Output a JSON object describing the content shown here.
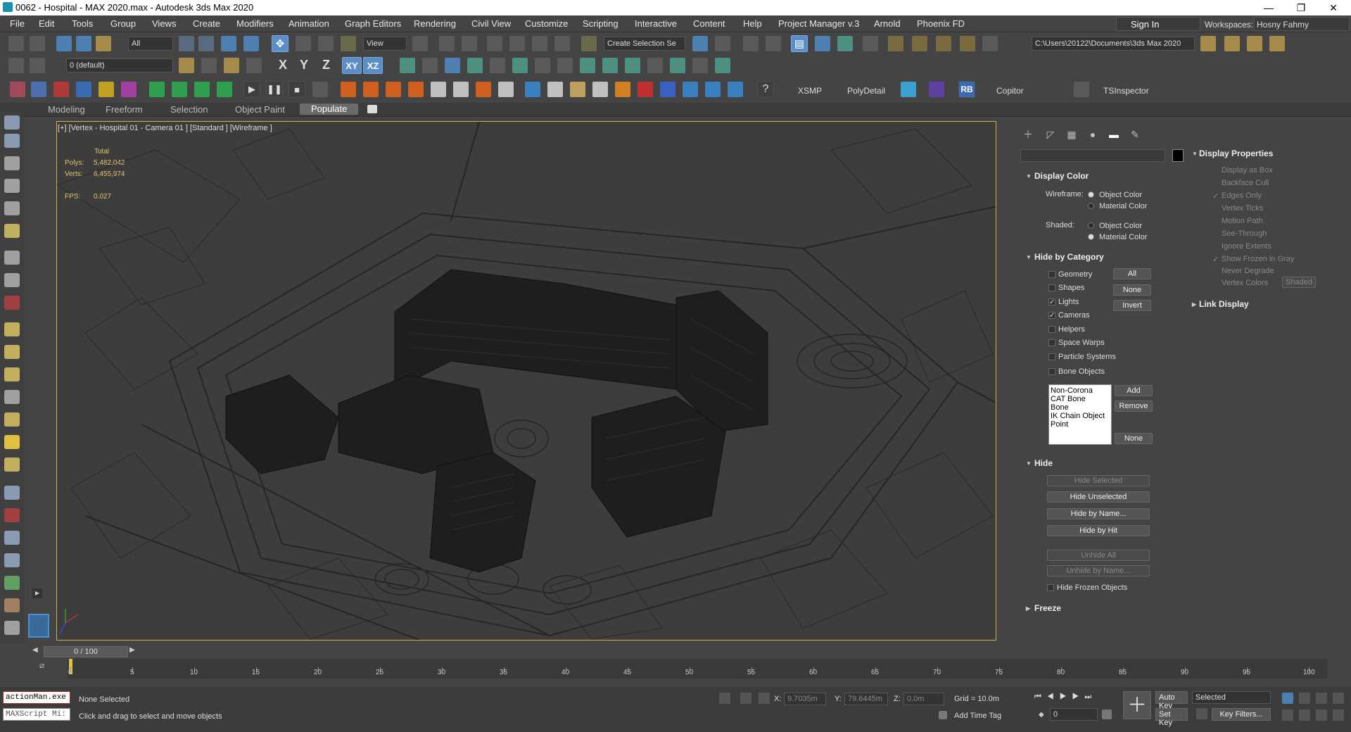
{
  "window": {
    "title": "0062 - Hospital - MAX 2020.max - Autodesk 3ds Max 2020",
    "minimize": "—",
    "maximize": "❐",
    "close": "✕"
  },
  "menu": [
    "File",
    "Edit",
    "Tools",
    "Group",
    "Views",
    "Create",
    "Modifiers",
    "Animation",
    "Graph Editors",
    "Rendering",
    "Civil View",
    "Customize",
    "Scripting",
    "Interactive",
    "Content",
    "Help",
    "Project Manager v.3",
    "Arnold",
    "Phoenix FD"
  ],
  "account": {
    "signin": "Sign In",
    "workspaces_label": "Workspaces:",
    "workspace": "Hosny Fahmy"
  },
  "toolbar": {
    "filter": "All",
    "refcoord": "View",
    "selset": "Create Selection Se",
    "path": "C:\\Users\\20122\\Documents\\3ds Max 2020",
    "layer": "0 (default)",
    "axis_x": "X",
    "axis_y": "Y",
    "axis_z": "Z",
    "axis_xy": "XY",
    "axis_xz": "XZ",
    "xsmp": "XSMP",
    "polydetail": "PolyDetail",
    "rb": "RB",
    "copitor": "Copitor",
    "tsinspector": "TSInspector"
  },
  "ribbon": {
    "tabs": [
      "Modeling",
      "Freeform",
      "Selection",
      "Object Paint",
      "Populate"
    ]
  },
  "viewport": {
    "label": "[+] [Vertex - Hospital 01 - Camera 01 ] [Standard ] [Wireframe ]",
    "stats_header": "Total",
    "polys_label": "Polys:",
    "polys": "5,482,042",
    "verts_label": "Verts:",
    "verts": "6,455,974",
    "fps_label": "FPS:",
    "fps": "0.027"
  },
  "display_panel": {
    "display_color": {
      "title": "Display Color",
      "wireframe_label": "Wireframe:",
      "shaded_label": "Shaded:",
      "object_color": "Object Color",
      "material_color": "Material Color"
    },
    "hide_by_category": {
      "title": "Hide by Category",
      "items": [
        {
          "label": "Geometry",
          "checked": false
        },
        {
          "label": "Shapes",
          "checked": false
        },
        {
          "label": "Lights",
          "checked": true
        },
        {
          "label": "Cameras",
          "checked": true
        },
        {
          "label": "Helpers",
          "checked": false
        },
        {
          "label": "Space Warps",
          "checked": false
        },
        {
          "label": "Particle Systems",
          "checked": false
        },
        {
          "label": "Bone Objects",
          "checked": false
        }
      ],
      "all": "All",
      "none": "None",
      "invert": "Invert",
      "list": [
        "Non-Corona",
        "CAT Bone",
        "Bone",
        "IK Chain Object",
        "Point"
      ],
      "add": "Add",
      "remove": "Remove",
      "none2": "None"
    },
    "hide": {
      "title": "Hide",
      "hide_selected": "Hide Selected",
      "hide_unselected": "Hide Unselected",
      "hide_by_name": "Hide by Name...",
      "hide_by_hit": "Hide by Hit",
      "unhide_all": "Unhide All",
      "unhide_by_name": "Unhide by Name...",
      "hide_frozen": "Hide Frozen Objects"
    },
    "freeze": {
      "title": "Freeze"
    }
  },
  "display_properties": {
    "title": "Display Properties",
    "items": [
      {
        "label": "Display as Box",
        "checked": false
      },
      {
        "label": "Backface Cull",
        "checked": false
      },
      {
        "label": "Edges Only",
        "checked": true
      },
      {
        "label": "Vertex Ticks",
        "checked": false
      },
      {
        "label": "Motion Path",
        "checked": false
      },
      {
        "label": "See-Through",
        "checked": false
      },
      {
        "label": "Ignore Extents",
        "checked": false
      },
      {
        "label": "Show Frozen in Gray",
        "checked": true
      },
      {
        "label": "Never Degrade",
        "checked": false
      },
      {
        "label": "Vertex Colors",
        "checked": false
      }
    ],
    "shaded_btn": "Shaded",
    "link_display": "Link Display"
  },
  "timeline": {
    "frame": "0 / 100",
    "ticks": [
      "0",
      "5",
      "10",
      "15",
      "20",
      "25",
      "30",
      "35",
      "40",
      "45",
      "50",
      "55",
      "60",
      "65",
      "70",
      "75",
      "80",
      "85",
      "90",
      "95",
      "100"
    ]
  },
  "status": {
    "script1": "actionMan.exe",
    "script2": "MAXScript Mi:",
    "selection": "None Selected",
    "prompt": "Click and drag to select and move objects",
    "x_label": "X:",
    "x_val": "9.7035m",
    "y_label": "Y:",
    "y_val": "79.6445m",
    "z_label": "Z:",
    "z_val": "0.0m",
    "grid": "Grid = 10.0m",
    "add_time_tag": "Add Time Tag",
    "auto_key": "Auto Key",
    "set_key": "Set Key",
    "selected": "Selected",
    "key_filters": "Key Filters...",
    "frame_field": "0"
  }
}
